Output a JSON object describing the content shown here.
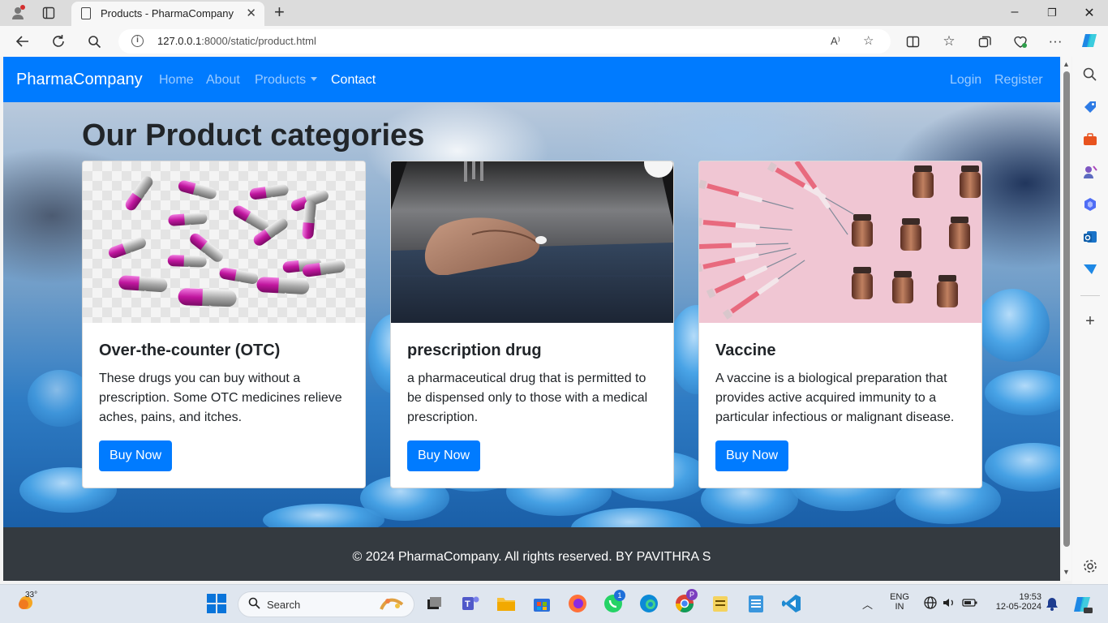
{
  "browser": {
    "tab_title": "Products - PharmaCompany",
    "url_host": "127.0.0.1",
    "url_rest": ":8000/static/product.html"
  },
  "site": {
    "brand": "PharmaCompany",
    "nav": {
      "home": "Home",
      "about": "About",
      "products": "Products",
      "contact": "Contact",
      "login": "Login",
      "register": "Register"
    },
    "heading": "Our Product categories",
    "cards": [
      {
        "title": "Over-the-counter (OTC)",
        "text": "These drugs you can buy without a prescription. Some OTC medicines relieve aches, pains, and itches.",
        "button": "Buy Now",
        "image": "capsules-image"
      },
      {
        "title": "prescription drug",
        "text": "a pharmaceutical drug that is permitted to be dispensed only to those with a medical prescription.",
        "button": "Buy Now",
        "image": "hand-holding-pill-image"
      },
      {
        "title": "Vaccine",
        "text": "A vaccine is a biological preparation that provides active acquired immunity to a particular infectious or malignant disease.",
        "button": "Buy Now",
        "image": "syringes-vials-image"
      }
    ],
    "footer": "© 2024 PharmaCompany. All rights reserved. BY PAVITHRA S"
  },
  "taskbar": {
    "weather": "33°",
    "search_label": "Search",
    "lang_top": "ENG",
    "lang_bottom": "IN",
    "time": "19:53",
    "date": "12-05-2024",
    "whatsapp_badge": "1",
    "chrome_profile": "P"
  },
  "colors": {
    "primary": "#007bff",
    "footer_bg": "#343a40",
    "heading_text": "#212529"
  }
}
